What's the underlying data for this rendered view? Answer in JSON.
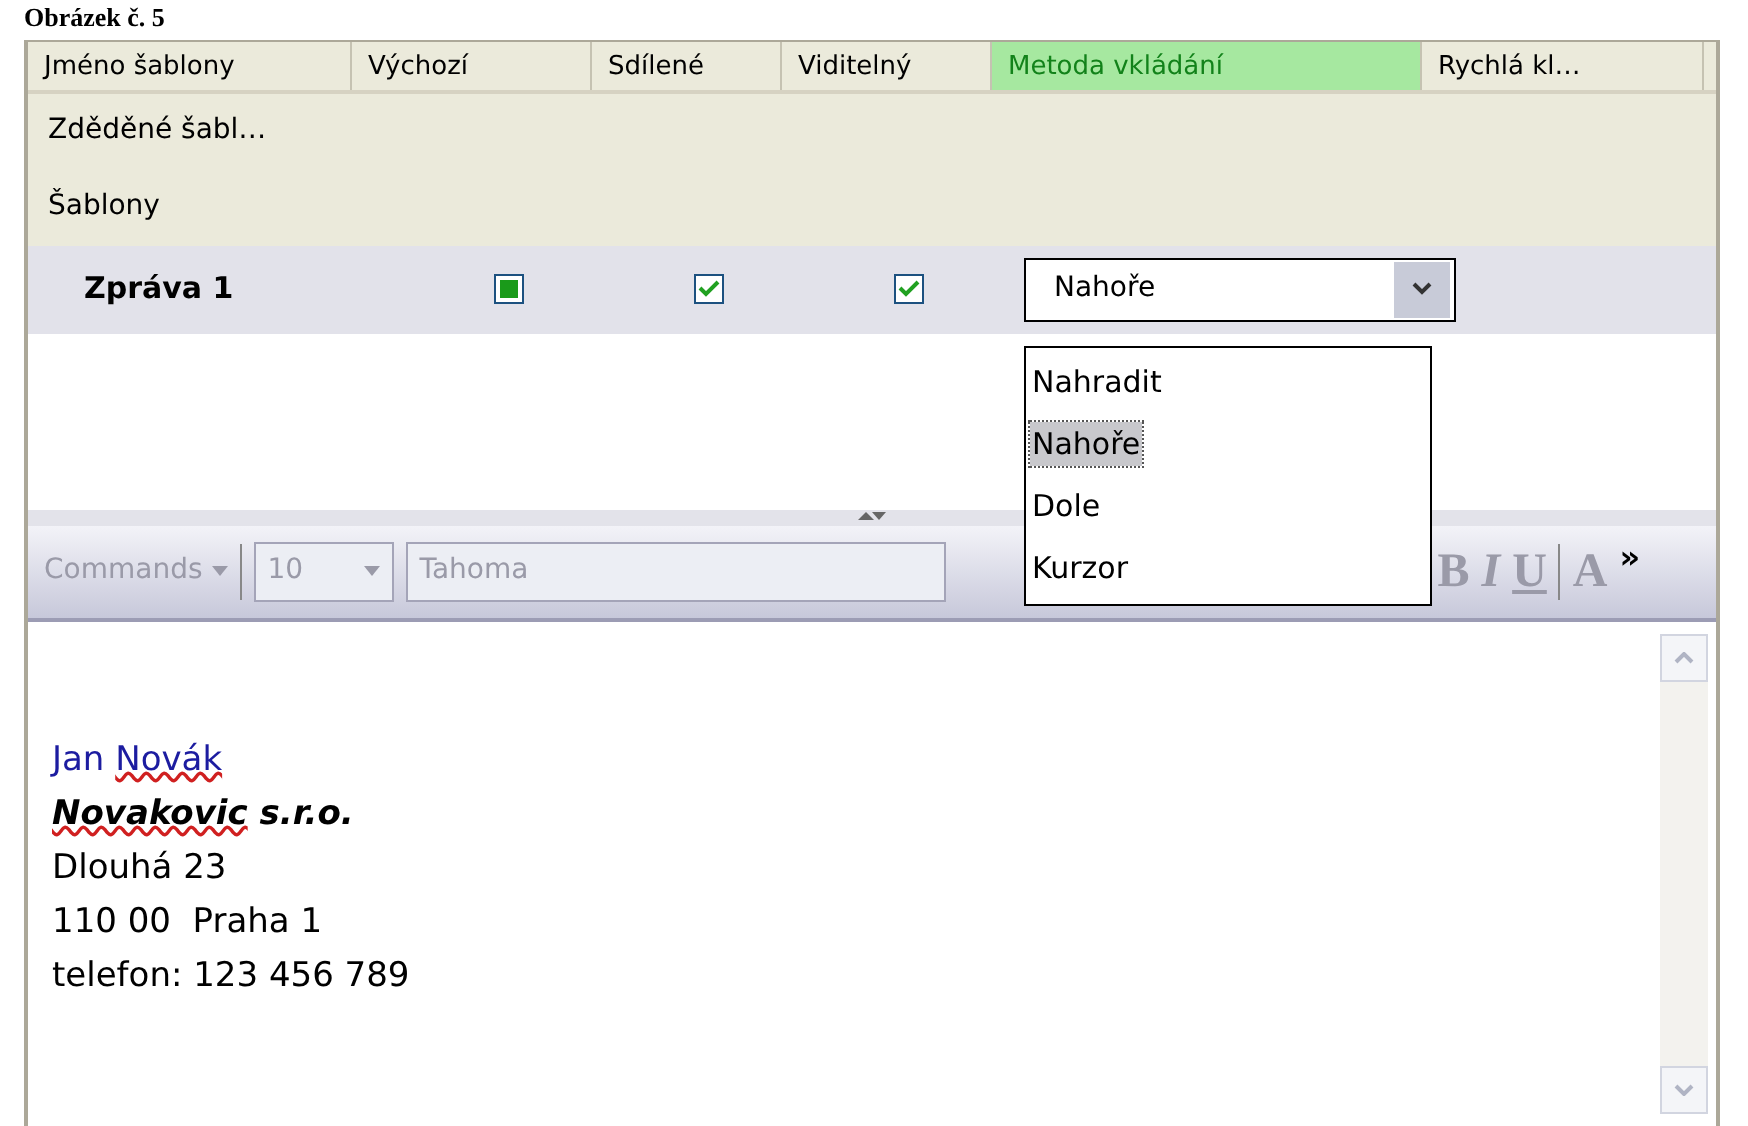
{
  "caption": "Obrázek č. 5",
  "columns": [
    {
      "label": "Jméno šablony",
      "selected": false
    },
    {
      "label": "Výchozí",
      "selected": false
    },
    {
      "label": "Sdílené",
      "selected": false
    },
    {
      "label": "Viditelný",
      "selected": false
    },
    {
      "label": "Metoda vkládání",
      "selected": true
    },
    {
      "label": "Rychlá kl…",
      "selected": false
    }
  ],
  "rows": [
    {
      "kind": "group",
      "name": "Zděděné šabl…"
    },
    {
      "kind": "group",
      "name": "Šablony"
    },
    {
      "kind": "template",
      "name": "Zpráva 1",
      "selected": true,
      "checks": [
        {
          "kind": "square",
          "checked": true
        },
        {
          "kind": "tick",
          "checked": true
        },
        {
          "kind": "tick",
          "checked": true
        }
      ],
      "method": "Nahoře",
      "expanded": true
    }
  ],
  "dropdown": {
    "options": [
      {
        "label": "Nahradit",
        "selected": false
      },
      {
        "label": "Nahoře",
        "selected": true
      },
      {
        "label": "Dole",
        "selected": false
      },
      {
        "label": "Kurzor",
        "selected": false
      }
    ]
  },
  "toolbar": {
    "disabled": true,
    "commands": "Commands",
    "font_size": "10",
    "font": "Tahoma",
    "bold": "B",
    "italic": "I",
    "underline": "U",
    "grow": "A",
    "more": "»"
  },
  "editor": {
    "lines": [
      {
        "kind": "name",
        "parts": [
          {
            "text": "Jan ",
            "misspelled": false
          },
          {
            "text": "Novák",
            "misspelled": true
          }
        ]
      },
      {
        "kind": "company",
        "parts": [
          {
            "text": "Novakovic",
            "misspelled": true
          },
          {
            "text": " s.r.o.",
            "misspelled": false
          }
        ]
      },
      {
        "kind": "plain",
        "parts": [
          {
            "text": "Dlouhá 23",
            "misspelled": false
          }
        ]
      },
      {
        "kind": "plain",
        "parts": [
          {
            "text": "110 00  Praha 1",
            "misspelled": false
          }
        ]
      },
      {
        "kind": "plain",
        "parts": [
          {
            "text": "telefon: 123 456 789",
            "misspelled": false
          }
        ]
      }
    ]
  }
}
